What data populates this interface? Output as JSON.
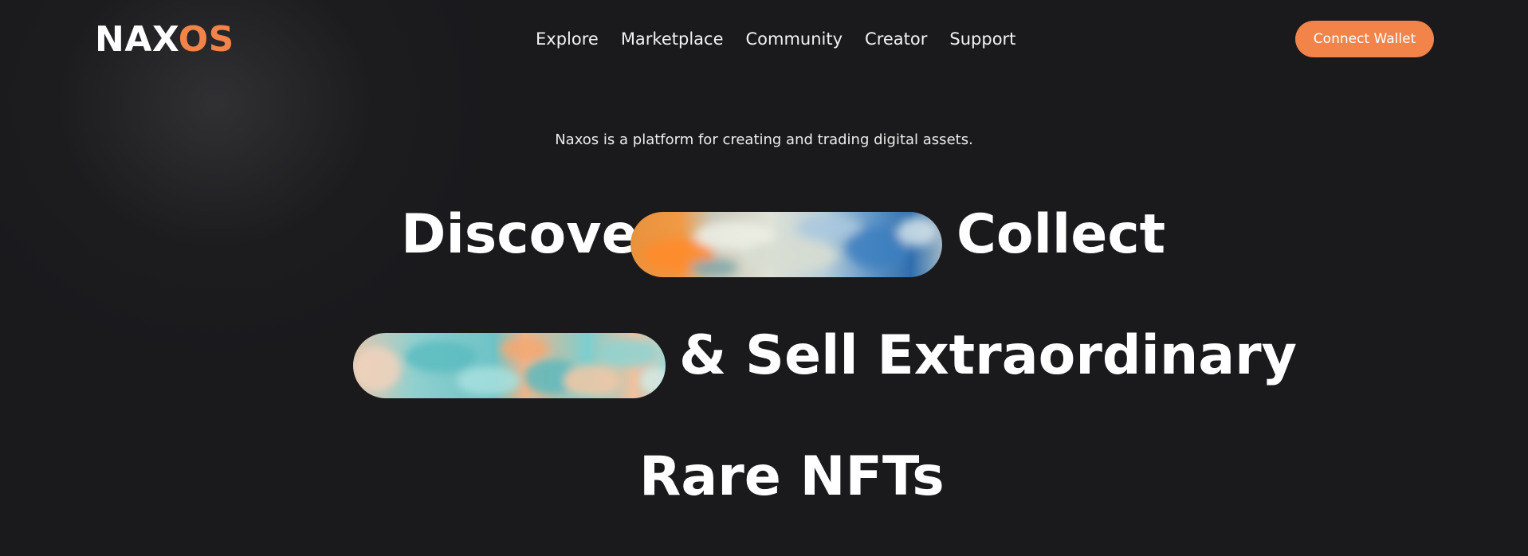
{
  "brand": {
    "part1": "NAX",
    "part2": "OS"
  },
  "nav": {
    "items": [
      {
        "label": "Explore"
      },
      {
        "label": "Marketplace"
      },
      {
        "label": "Community"
      },
      {
        "label": "Creator"
      },
      {
        "label": "Support"
      }
    ]
  },
  "header": {
    "connect_label": "Connect Wallet"
  },
  "hero": {
    "tagline": "Naxos is a platform for creating and trading digital assets.",
    "line1_word1": "Discover",
    "line1_word2": "Collect",
    "line2_text": "& Sell Extraordinary",
    "line3_text": "Rare NFTs"
  },
  "colors": {
    "accent": "#f2844a",
    "background": "#1a1a1d",
    "text": "#ffffff"
  }
}
